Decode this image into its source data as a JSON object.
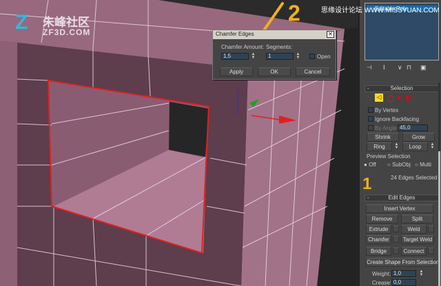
{
  "watermark_left": {
    "cn": "朱峰社区",
    "en": "ZF3D.COM"
  },
  "watermark_right": "思缘设计论坛 WWW.MISSYUAN.COM",
  "annotations": [
    "1",
    "2"
  ],
  "dialog": {
    "title": "Chamfer Edges",
    "close": "✕",
    "amount_label": "Chamfer Amount:",
    "amount_value": "1,5",
    "segments_label": "Segments:",
    "segments_value": "1",
    "open_label": "Open",
    "apply": "Apply",
    "ok": "OK",
    "cancel": "Cancel"
  },
  "modifier_stack": {
    "item": "Editable Poly"
  },
  "selection": {
    "title": "Selection",
    "collapse": "-",
    "by_vertex": "By Vertex",
    "ignore_backfacing": "Ignore Backfacing",
    "by_angle": "By Angle:",
    "angle_value": "45,0",
    "shrink": "Shrink",
    "grow": "Grow",
    "ring": "Ring",
    "loop": "Loop",
    "preview_title": "Preview Selection",
    "off": "Off",
    "subobj": "SubObj",
    "multi": "Multi",
    "status": "24 Edges Selected"
  },
  "edit_edges": {
    "title": "Edit Edges",
    "collapse": "-",
    "insert_vertex": "Insert Vertex",
    "remove": "Remove",
    "split": "Split",
    "extrude": "Extrude",
    "weld": "Weld",
    "chamfer": "Chamfer",
    "target_weld": "Target Weld",
    "bridge": "Bridge",
    "connect": "Connect",
    "create_shape": "Create Shape From Selection",
    "weight_label": "Weight:",
    "weight_value": "1,0",
    "crease_label": "Crease:",
    "crease_value": "0,0"
  },
  "colors": {
    "accent_arrow": "#f0b020",
    "selected_edge": "#e02020",
    "mesh": "#9a6a80"
  }
}
